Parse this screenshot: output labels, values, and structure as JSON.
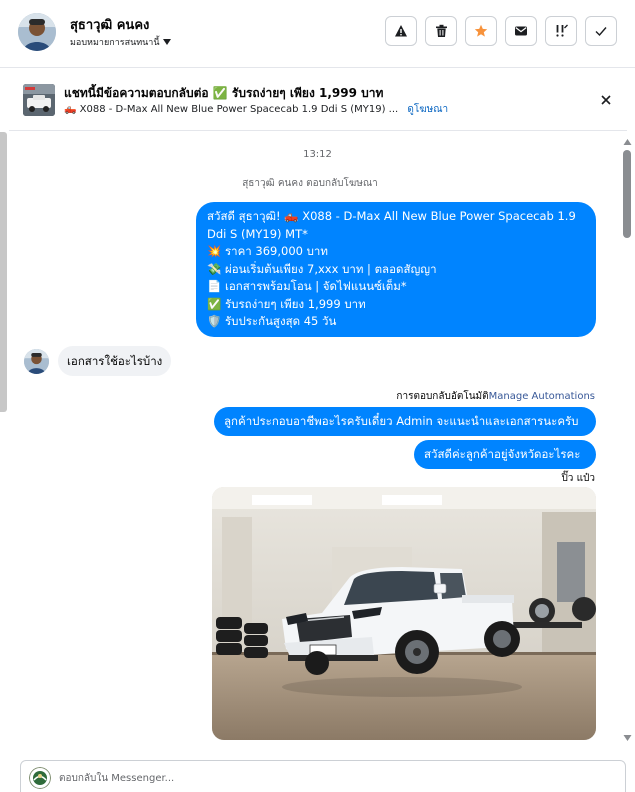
{
  "header": {
    "user_name": "สุธาวุฒิ คนคง",
    "assign_label": "มอบหมายการสนทนานี้",
    "actions": [
      {
        "name": "report",
        "icon": "warning-icon"
      },
      {
        "name": "delete",
        "icon": "trash-icon"
      },
      {
        "name": "star",
        "icon": "star-icon",
        "color": "#f7923b"
      },
      {
        "name": "mark-unread",
        "icon": "envelope-icon"
      },
      {
        "name": "follow-up",
        "icon": "follow-up-icon"
      },
      {
        "name": "mark-done",
        "icon": "checkmark-icon"
      }
    ]
  },
  "ad": {
    "title": "แชทนี้มีข้อความตอบกลับต่อ ✅ รับรถง่ายๆ เพียง 1,999 บาท",
    "subtitle": "🛻 X088 - D-Max All New Blue Power Spacecab 1.9 Ddi S (MY19) ...",
    "link": "ดูโฆษณา"
  },
  "thread": {
    "timestamp": "13:12",
    "reply_note": "สุธาวุฒิ คนคง ตอบกลับโฆษณา",
    "promo_lines": [
      "สวัสดี สุธาวุฒิ! 🛻 X088 - D-Max All New Blue Power Spacecab 1.9",
      "Ddi S (MY19) MT*",
      "💥 ราคา 369,000 บาท",
      "💸 ผ่อนเริ่มต้นเพียง 7,xxx บาท | ตลอดสัญญา",
      "📄 เอกสารพร้อมโอน | จัดไฟแนนซ์เต็ม*",
      "✅ รับรถง่ายๆ เพียง 1,999 บาท",
      "🛡️ รับประกันสูงสุด 45 วัน"
    ],
    "incoming_message": "เอกสารใช้อะไรบ้าง",
    "auto_reply_label": "การตอบกลับอัตโนมัติ",
    "manage_automations": "Manage Automations",
    "reply_1": "ลูกค้าประกอบอาชีพอะไรครับเดี๋ยว Admin จะแนะนำและเอกสารนะครับ",
    "reply_2": "สวัสดีค่ะลูกค้าอยู่จังหวัดอะไรคะ",
    "sender_name": "ปิ๊ว แป๋ว",
    "photo_subject": "white-pickup-truck-photo"
  },
  "composer": {
    "placeholder": "ตอบกลับใน Messenger..."
  },
  "colors": {
    "accent": "#0084ff",
    "incoming_bubble": "#f0f2f5",
    "star": "#f7923b",
    "link": "#385898"
  }
}
